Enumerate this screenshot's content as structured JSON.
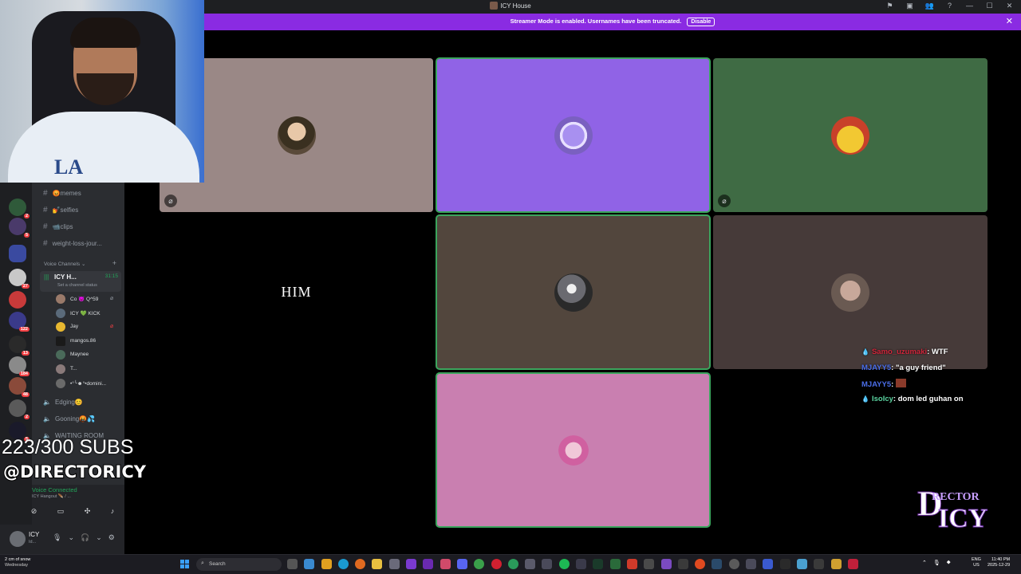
{
  "window": {
    "title": "ICY House",
    "icons": [
      "inbox-icon",
      "screen-icon",
      "people-icon",
      "help-icon",
      "minimize-icon",
      "maximize-icon",
      "close-icon"
    ]
  },
  "banner": {
    "message": "Streamer Mode is enabled. Usernames have been truncated.",
    "button": "Disable",
    "close": "✕"
  },
  "sidebar": {
    "channels": [
      {
        "name": "memes",
        "emoji": "😡"
      },
      {
        "name": "selfies",
        "emoji": "💅"
      },
      {
        "name": "clips",
        "emoji": "📹"
      },
      {
        "name": "weight-loss-jour...",
        "emoji": ""
      }
    ],
    "voice_header": "Voice Channels",
    "active_voice": {
      "name": "ICY H...",
      "time": "31:15",
      "status": "Set a channel status"
    },
    "members": [
      {
        "name": "Co 😈 Q^59"
      },
      {
        "name": "ICY 💚 KICK"
      },
      {
        "name": "Jay"
      },
      {
        "name": "mangos.86"
      },
      {
        "name": "Maynee"
      },
      {
        "name": "T..."
      },
      {
        "name": "•°╰☻°•domini..."
      }
    ],
    "other_voice": [
      {
        "name": "Edging😊"
      },
      {
        "name": "Gooning🤬💦"
      },
      {
        "name": "WAITING ROOM"
      }
    ],
    "voice_connected": {
      "title": "Voice Connected",
      "channel": "ICY Hangout 🪶 / ..."
    },
    "user": {
      "name": "ICY",
      "status": "Id..."
    },
    "guild_badges": [
      "2",
      "5",
      "27",
      "122",
      "13",
      "184",
      "48",
      "2",
      "5"
    ]
  },
  "overlay": {
    "subs": "223/300 SUBS",
    "handle": "@DIRECTORICY"
  },
  "tiles": {
    "him_label": "HIM"
  },
  "chat": [
    {
      "user": "Samo_uzumaki",
      "msg": ": WTF",
      "drop": true
    },
    {
      "user": "MJAYY5",
      "msg": ": \"a guy friend\"",
      "drop": false
    },
    {
      "user": "MJAYY5",
      "msg": ": ",
      "drop": false,
      "emote": true
    },
    {
      "user": "IsoIcy",
      "msg": ": dom led guhan on",
      "drop": true
    }
  ],
  "brand": {
    "letter_d": "D",
    "rector": "RECTOR",
    "icy": "ICY"
  },
  "taskbar": {
    "weather_line1": "2 cm of snow",
    "weather_line2": "Wednesday",
    "search": "Search",
    "lang1": "ENG",
    "lang2": "US",
    "time": "11:40 PM",
    "date": "2025-12-29"
  },
  "colors": {
    "banner": "#8a2be2",
    "speaking_outline": "#3ba55d",
    "tile_1": "#9a8886",
    "tile_2": "#9063e6",
    "tile_3": "#3f6b44",
    "tile_4": "#52463d",
    "tile_5": "#463a39",
    "tile_6": "#c97fb0"
  }
}
